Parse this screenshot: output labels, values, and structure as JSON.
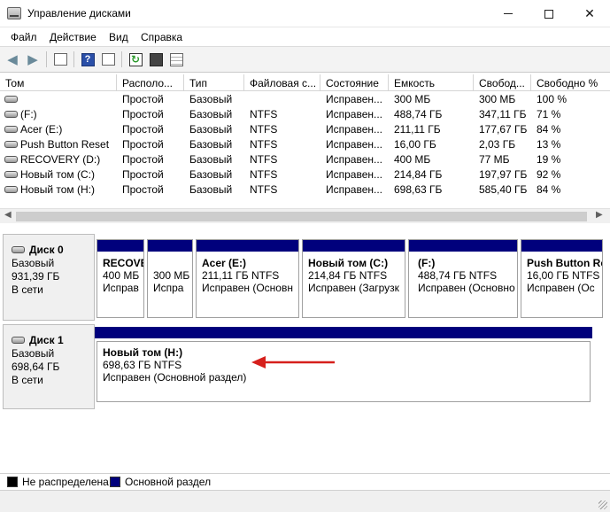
{
  "window": {
    "title": "Управление дисками",
    "minimize_icon": "minimize-icon",
    "maximize_icon": "maximize-icon",
    "close_glyph": "✕"
  },
  "menu": [
    "Файл",
    "Действие",
    "Вид",
    "Справка"
  ],
  "toolbar": {
    "icons": [
      "back-arrow-icon",
      "forward-arrow-icon",
      "disk-list-icon",
      "help-icon",
      "console-tree-icon",
      "refresh-icon",
      "rescan-icon",
      "properties-icon"
    ],
    "help_glyph": "?",
    "refresh_glyph": "↻"
  },
  "volume_columns": [
    "Том",
    "Располо...",
    "Тип",
    "Файловая с...",
    "Состояние",
    "Емкость",
    "Свобод...",
    "Свободно %"
  ],
  "volumes": [
    {
      "name": "",
      "layout": "Простой",
      "type": "Базовый",
      "fs": "",
      "status": "Исправен...",
      "capacity": "300 МБ",
      "free": "300 МБ",
      "free_pct": "100 %"
    },
    {
      "name": "(F:)",
      "layout": "Простой",
      "type": "Базовый",
      "fs": "NTFS",
      "status": "Исправен...",
      "capacity": "488,74 ГБ",
      "free": "347,11 ГБ",
      "free_pct": "71 %"
    },
    {
      "name": "Acer (E:)",
      "layout": "Простой",
      "type": "Базовый",
      "fs": "NTFS",
      "status": "Исправен...",
      "capacity": "211,11 ГБ",
      "free": "177,67 ГБ",
      "free_pct": "84 %"
    },
    {
      "name": "Push Button Reset",
      "layout": "Простой",
      "type": "Базовый",
      "fs": "NTFS",
      "status": "Исправен...",
      "capacity": "16,00 ГБ",
      "free": "2,03 ГБ",
      "free_pct": "13 %"
    },
    {
      "name": "RECOVERY (D:)",
      "layout": "Простой",
      "type": "Базовый",
      "fs": "NTFS",
      "status": "Исправен...",
      "capacity": "400 МБ",
      "free": "77 МБ",
      "free_pct": "19 %"
    },
    {
      "name": "Новый том (C:)",
      "layout": "Простой",
      "type": "Базовый",
      "fs": "NTFS",
      "status": "Исправен...",
      "capacity": "214,84 ГБ",
      "free": "197,97 ГБ",
      "free_pct": "92 %"
    },
    {
      "name": "Новый том (H:)",
      "layout": "Простой",
      "type": "Базовый",
      "fs": "NTFS",
      "status": "Исправен...",
      "capacity": "698,63 ГБ",
      "free": "585,40 ГБ",
      "free_pct": "84 %"
    }
  ],
  "scrollbar": {
    "left_glyph": "◀",
    "right_glyph": "▶"
  },
  "disks": [
    {
      "title": "Диск 0",
      "type": "Базовый",
      "size": "931,39 ГБ",
      "state": "В сети",
      "partitions": [
        {
          "name": "RECOVE",
          "size": "400 МБ",
          "status": "Исправ"
        },
        {
          "name": "",
          "size": "300 МБ",
          "status": "Испра"
        },
        {
          "name": "Acer (E:)",
          "size": "211,11 ГБ NTFS",
          "status": "Исправен (Основн"
        },
        {
          "name": "Новый том (C:)",
          "size": "214,84 ГБ NTFS",
          "status": "Исправен (Загрузк"
        },
        {
          "name": "(F:)",
          "size": "488,74 ГБ NTFS",
          "status": "Исправен (Основно"
        },
        {
          "name": "Push Button Re",
          "size": "16,00 ГБ NTFS",
          "status": "Исправен (Ос"
        }
      ]
    },
    {
      "title": "Диск 1",
      "type": "Базовый",
      "size": "698,64 ГБ",
      "state": "В сети",
      "partitions": [
        {
          "name": "Новый том (H:)",
          "size": "698,63 ГБ NTFS",
          "status": "Исправен (Основной раздел)"
        }
      ]
    }
  ],
  "legend": [
    {
      "label": "Не распределена",
      "color": "#000000"
    },
    {
      "label": "Основной раздел",
      "color": "#00007c"
    }
  ],
  "colors": {
    "partition_bar": "#00007c",
    "arrow": "#d6201c"
  }
}
